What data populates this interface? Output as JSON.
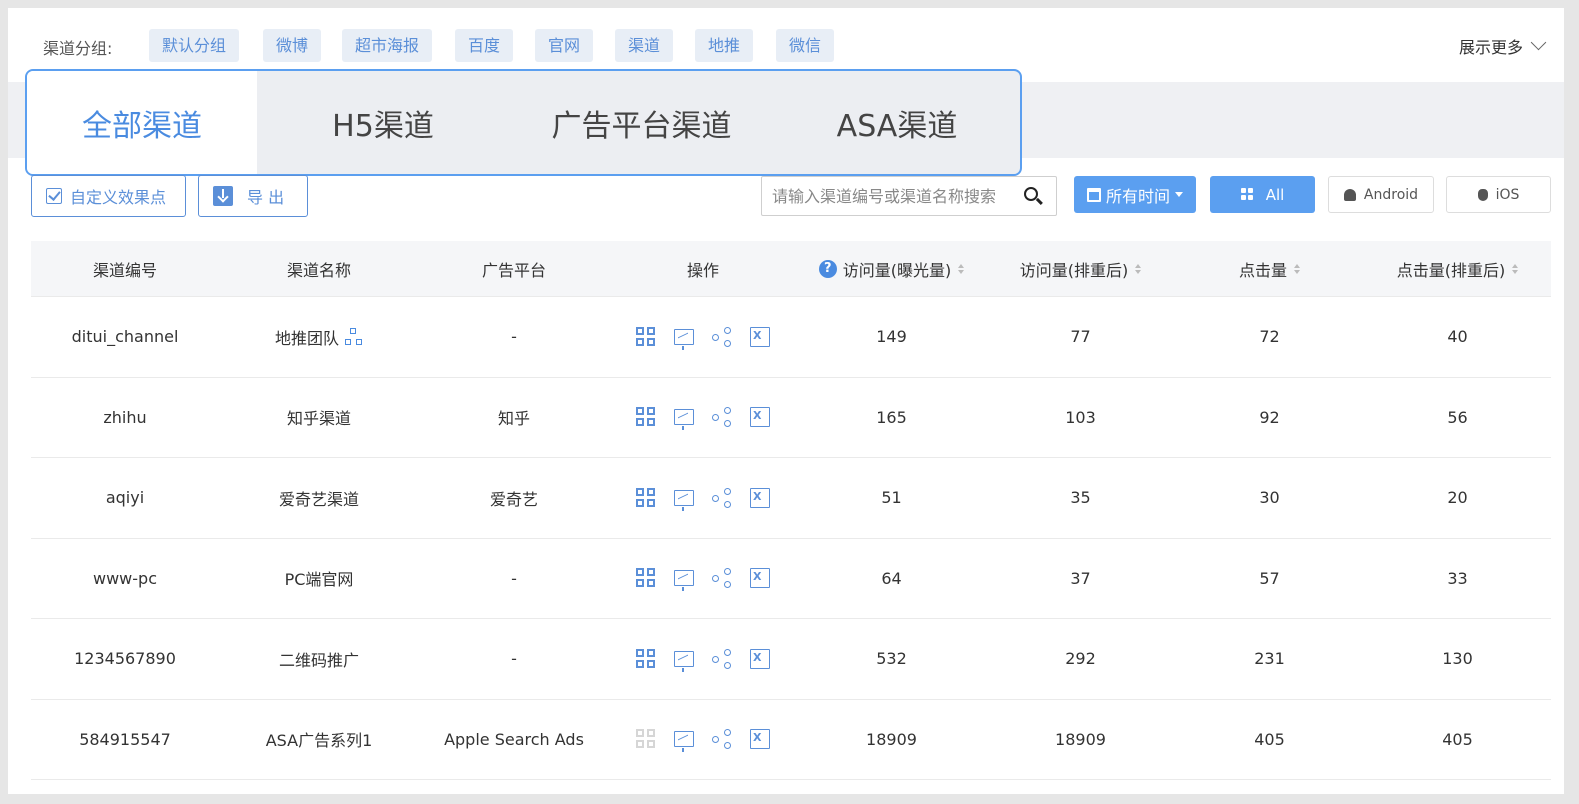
{
  "groups": {
    "label": "渠道分组:",
    "chips": [
      "默认分组",
      "微博",
      "超市海报",
      "百度",
      "官网",
      "渠道",
      "地推",
      "微信"
    ],
    "show_more": "展示更多"
  },
  "tabs": [
    "全部渠道",
    "H5渠道",
    "广告平台渠道",
    "ASA渠道"
  ],
  "active_tab": 0,
  "toolbar": {
    "custom_label": "自定义效果点",
    "export_label": "导 出",
    "search_placeholder": "请输入渠道编号或渠道名称搜索",
    "time_label": "所有时间",
    "platform_all": "All",
    "platform_android": "Android",
    "platform_ios": "iOS"
  },
  "table": {
    "headers": [
      "渠道编号",
      "渠道名称",
      "广告平台",
      "操作",
      "访问量(曝光量)",
      "访问量(排重后)",
      "点击量",
      "点击量(排重后)"
    ],
    "rows": [
      {
        "id": "ditui_channel",
        "name": "地推团队",
        "platform": "-",
        "visits": "149",
        "visits_uniq": "77",
        "clicks": "72",
        "clicks_uniq": "40"
      },
      {
        "id": "zhihu",
        "name": "知乎渠道",
        "platform": "知乎",
        "visits": "165",
        "visits_uniq": "103",
        "clicks": "92",
        "clicks_uniq": "56"
      },
      {
        "id": "aqiyi",
        "name": "爱奇艺渠道",
        "platform": "爱奇艺",
        "visits": "51",
        "visits_uniq": "35",
        "clicks": "30",
        "clicks_uniq": "20"
      },
      {
        "id": "www-pc",
        "name": "PC端官网",
        "platform": "-",
        "visits": "64",
        "visits_uniq": "37",
        "clicks": "57",
        "clicks_uniq": "33"
      },
      {
        "id": "1234567890",
        "name": "二维码推广",
        "platform": "-",
        "visits": "532",
        "visits_uniq": "292",
        "clicks": "231",
        "clicks_uniq": "130"
      },
      {
        "id": "584915547",
        "name": "ASA广告系列1",
        "platform": "Apple Search Ads",
        "visits": "18909",
        "visits_uniq": "18909",
        "clicks": "405",
        "clicks_uniq": "405"
      }
    ]
  },
  "colors": {
    "accent": "#4a8be0",
    "primary_button": "#5b9ff0",
    "chip_bg": "#e8eef6"
  },
  "icons": [
    "checkbox-icon",
    "download-icon",
    "search-icon",
    "calendar-icon",
    "grid-icon",
    "android-icon",
    "apple-icon",
    "help-icon",
    "org-chart-icon",
    "qrcode-icon",
    "trend-chart-icon",
    "share-icon",
    "excel-icon",
    "chevron-down-icon",
    "sort-icon"
  ]
}
